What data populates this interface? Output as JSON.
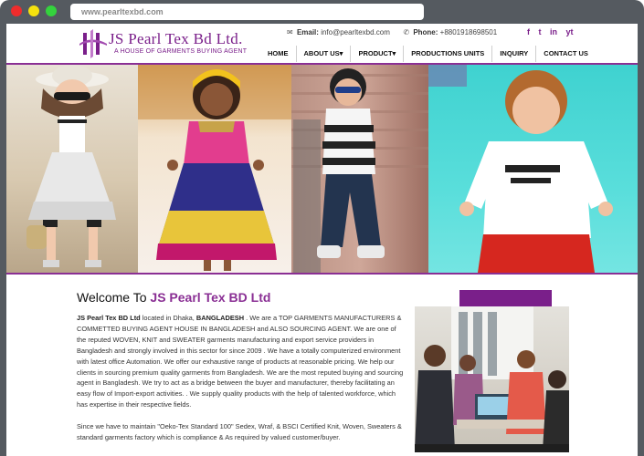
{
  "browser": {
    "url": "www.pearltexbd.com"
  },
  "header": {
    "logo_name": "JS Pearl Tex Bd Ltd.",
    "logo_tagline": "A HOUSE OF GARMENTS BUYING AGENT",
    "email_label": "Email:",
    "email_value": "info@pearltexbd.com",
    "phone_label": "Phone:",
    "phone_value": "+8801918698501",
    "social": [
      "f",
      "t",
      "in",
      "yt"
    ]
  },
  "nav": {
    "items": [
      "HOME",
      "ABOUT US",
      "PRODUCT",
      "PRODUCTIONS UNITS",
      "INQUIRY",
      "CONTACT US"
    ]
  },
  "welcome": {
    "prefix": "Welcome To ",
    "brand": "JS Pearl Tex BD Ltd",
    "p1_strong": "JS Pearl Tex BD Ltd",
    "p1_a": " located in Dhaka, ",
    "p1_strong2": "BANGLADESH",
    "p1_b": " . We are a  TOP GARMENTS MANUFACTURERS & COMMETTED BUYING AGENT HOUSE IN BANGLADESH and ALSO SOURCING AGENT. We are one of the reputed WOVEN, KNIT and SWEATER  garments manufacturing and export service providers in Bangladesh and strongly involved in this sector for since 2009 . We have a totally computerized environment with latest office Automation. We offer our exhaustive range of products at reasonable pricing. We help our clients in sourcing premium quality garments from Bangladesh. We are the most reputed buying and sourcing agent in Bangladesh. We try to act as a bridge between the buyer and manufacturer, thereby facilitating an easy flow of Import-export activities. . We supply quality products with the help of talented workforce, which has expertise in their respective fields.",
    "p2": "Since we have to maintain \"Oeko-Tex Standard 100\" Sedex, Wraf, & BSCI Certified Knit, Woven, Sweaters & standard garments factory which is compliance & As required by valued customer/buyer."
  },
  "colors": {
    "brand_purple": "#7a1f8a",
    "chrome_gray": "#555a60"
  }
}
